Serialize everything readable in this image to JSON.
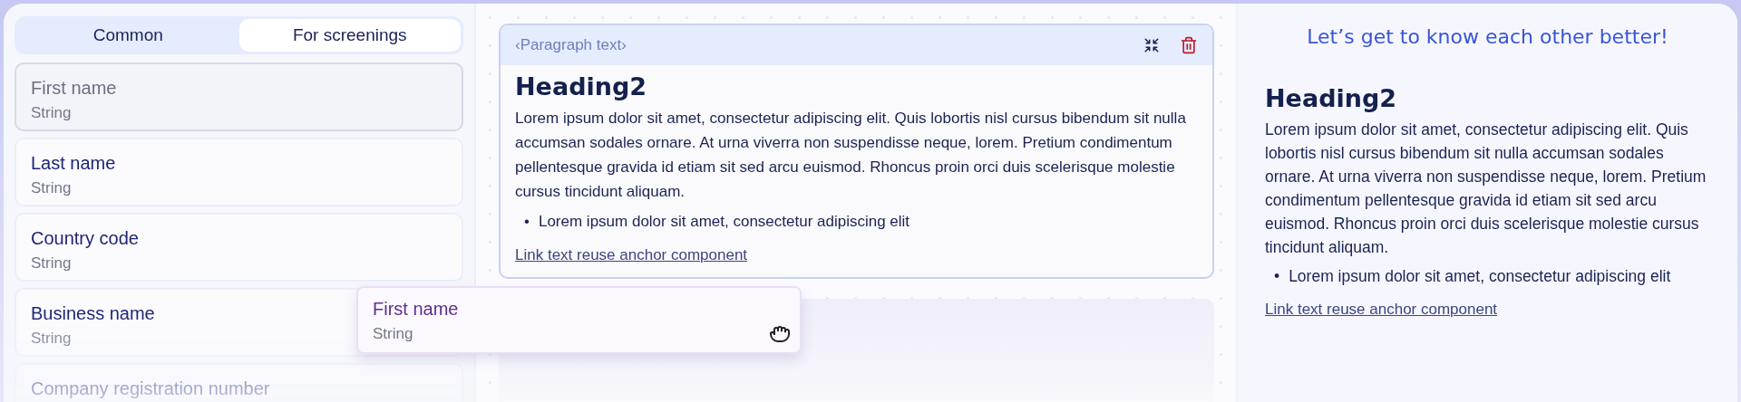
{
  "tabs": [
    {
      "label": "Common",
      "selected": false
    },
    {
      "label": "For screenings",
      "selected": true
    }
  ],
  "fields": [
    {
      "name": "First name",
      "type": "String",
      "dragging": true
    },
    {
      "name": "Last name",
      "type": "String",
      "dragging": false
    },
    {
      "name": "Country code",
      "type": "String",
      "dragging": false
    },
    {
      "name": "Business name",
      "type": "String",
      "dragging": false
    },
    {
      "name": "Company registration number",
      "dragging": false
    }
  ],
  "drag_preview": {
    "name": "First name",
    "type": "String"
  },
  "editor_block": {
    "tag": "‹Paragraph text›",
    "heading": "Heading2",
    "paragraph": "Lorem ipsum dolor sit amet, consectetur adipiscing elit. Quis lobortis nisl cursus bibendum sit nulla accumsan sodales ornare. At urna viverra non suspendisse neque, lorem. Pretium condimentum pellentesque gravida id etiam sit sed arcu euismod. Rhoncus proin orci duis scelerisque molestie cursus tincidunt aliquam.",
    "bullets": [
      {
        "marker": "•",
        "text": "Lorem ipsum dolor sit amet, consectetur adipiscing elit"
      }
    ],
    "link": "Link text reuse anchor component"
  },
  "preview": {
    "title": "Let’s get to know each other better!",
    "heading": "Heading2",
    "paragraph": "Lorem ipsum dolor sit amet, consectetur adipiscing elit. Quis lobortis nisl cursus bibendum sit nulla accumsan sodales ornare. At urna viverra non suspendisse neque, lorem. Pretium condimentum pellentesque gravida id etiam sit sed arcu euismod. Rhoncus proin orci duis scelerisque molestie cursus tincidunt aliquam.",
    "bullets": [
      {
        "marker": "•",
        "text": "Lorem ipsum dolor sit amet, consectetur adipiscing elit"
      }
    ],
    "link": "Link text reuse anchor component"
  }
}
